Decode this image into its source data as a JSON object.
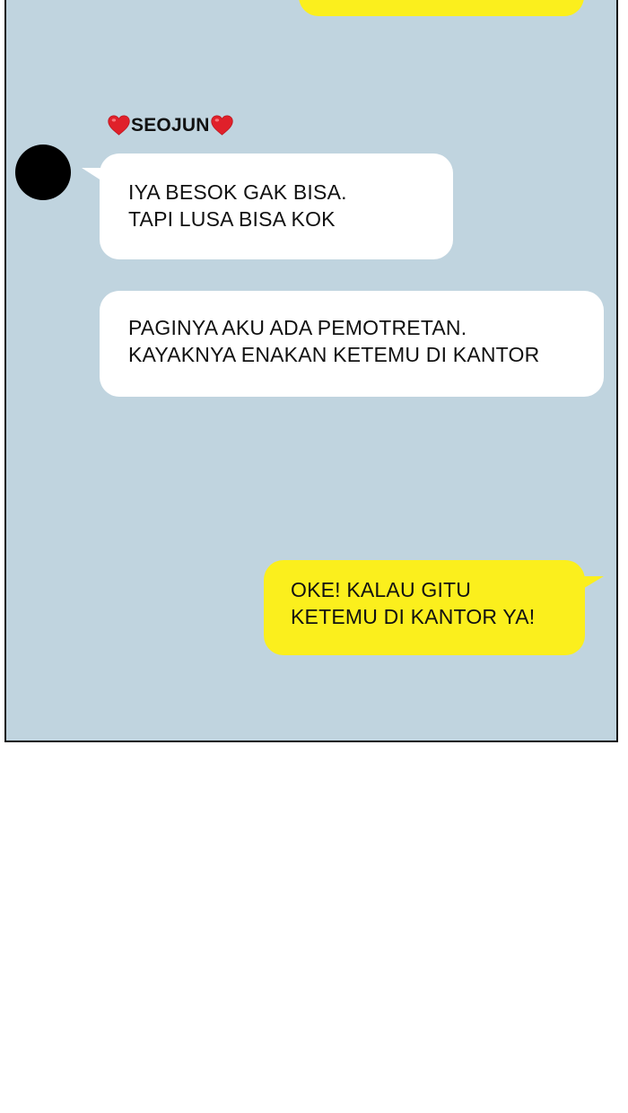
{
  "chat": {
    "sender": {
      "name": "SEOJUN",
      "prefix_icon": "red-heart-icon",
      "suffix_icon": "red-heart-icon"
    },
    "messages": [
      {
        "from": "other",
        "lines": [
          "IYA BESOK GAK BISA.",
          "TAPI LUSA BISA KOK"
        ]
      },
      {
        "from": "other",
        "lines": [
          "PAGINYA AKU ADA PEMOTRETAN.",
          "KAYAKNYA ENAKAN KETEMU DI KANTOR"
        ]
      },
      {
        "from": "self",
        "lines": [
          "OKE! KALAU GITU",
          "KETEMU DI KANTOR YA!"
        ]
      }
    ]
  },
  "colors": {
    "chat_background": "#c0d4df",
    "incoming_bubble": "#ffffff",
    "outgoing_bubble": "#fbef1d",
    "avatar": "#000000",
    "heart": "#e0202a"
  }
}
